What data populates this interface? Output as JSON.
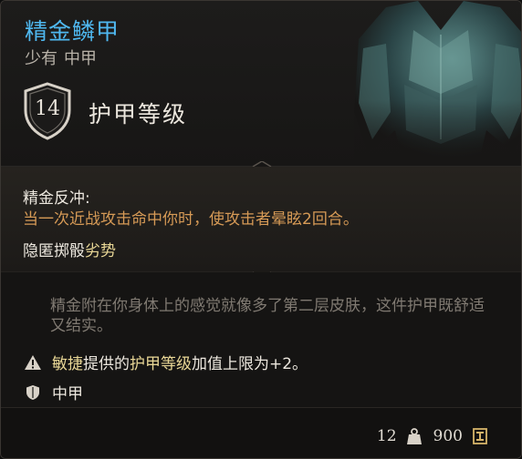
{
  "item": {
    "name": "精金鳞甲",
    "rarity": "少有",
    "type": "中甲"
  },
  "armor_class": {
    "value": "14",
    "label": "护甲等级"
  },
  "ability": {
    "title": "精金反冲:",
    "description": "当一次近战攻击命中你时，使攻击者晕眩2回合。",
    "extra_prefix": "隐匿掷骰",
    "extra_highlight": "劣势"
  },
  "lore": {
    "text": "精金附在你身体上的感觉就像多了第二层皮肤，这件护甲既舒适又结实。"
  },
  "notes": {
    "dex_part1": "敏捷",
    "dex_part2": "提供的",
    "dex_part3": "护甲等级",
    "dex_part4": "加值上限为+2。",
    "proficiency": "中甲"
  },
  "footer": {
    "weight": "12",
    "value": "900"
  },
  "colors": {
    "name": "#4fb8f0",
    "ability_desc": "#d69a56",
    "highlight": "#e9d796"
  },
  "icons": [
    "shield-ac-icon",
    "warning-icon",
    "armor-proficiency-icon",
    "weight-icon",
    "gold-icon"
  ]
}
